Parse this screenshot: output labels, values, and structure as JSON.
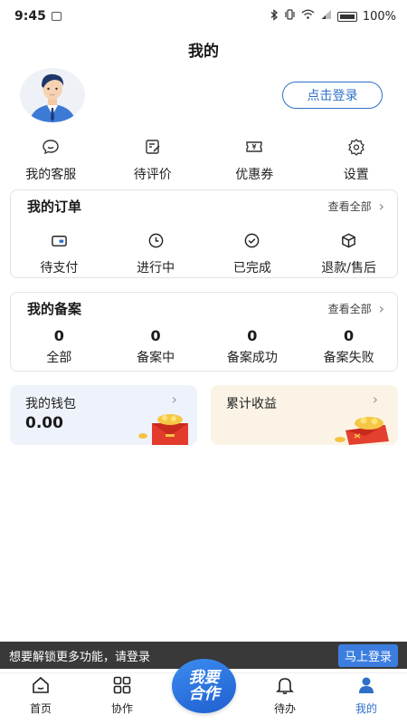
{
  "status_bar": {
    "time": "9:45",
    "battery": "100%"
  },
  "page_title": "我的",
  "login_button": "点击登录",
  "quick_actions": [
    {
      "label": "我的客服",
      "icon": "chat-icon"
    },
    {
      "label": "待评价",
      "icon": "edit-icon"
    },
    {
      "label": "优惠券",
      "icon": "coupon-icon"
    },
    {
      "label": "设置",
      "icon": "gear-icon"
    }
  ],
  "orders": {
    "title": "我的订单",
    "view_all": "查看全部",
    "items": [
      {
        "label": "待支付",
        "icon": "wallet-icon"
      },
      {
        "label": "进行中",
        "icon": "clock-icon"
      },
      {
        "label": "已完成",
        "icon": "check-circle-icon"
      },
      {
        "label": "退款/售后",
        "icon": "box-icon"
      }
    ]
  },
  "records": {
    "title": "我的备案",
    "view_all": "查看全部",
    "items": [
      {
        "value": "0",
        "label": "全部"
      },
      {
        "value": "0",
        "label": "备案中"
      },
      {
        "value": "0",
        "label": "备案成功"
      },
      {
        "value": "0",
        "label": "备案失败"
      }
    ]
  },
  "wallet": {
    "title": "我的钱包",
    "value": "0.00"
  },
  "earnings": {
    "title": "累计收益"
  },
  "banner": {
    "message": "想要解锁更多功能，请登录",
    "action": "马上登录"
  },
  "tabbar": {
    "center": [
      "我要",
      "合作"
    ],
    "tabs": [
      {
        "label": "首页",
        "icon": "home-icon"
      },
      {
        "label": "协作",
        "icon": "grid-icon"
      },
      {
        "label": "待办",
        "icon": "bell-icon"
      },
      {
        "label": "我的",
        "icon": "user-icon"
      }
    ]
  },
  "colors": {
    "accent": "#2f6fc8",
    "wallet_bg": "#eef2fb",
    "earnings_bg": "#fbf4e6"
  }
}
